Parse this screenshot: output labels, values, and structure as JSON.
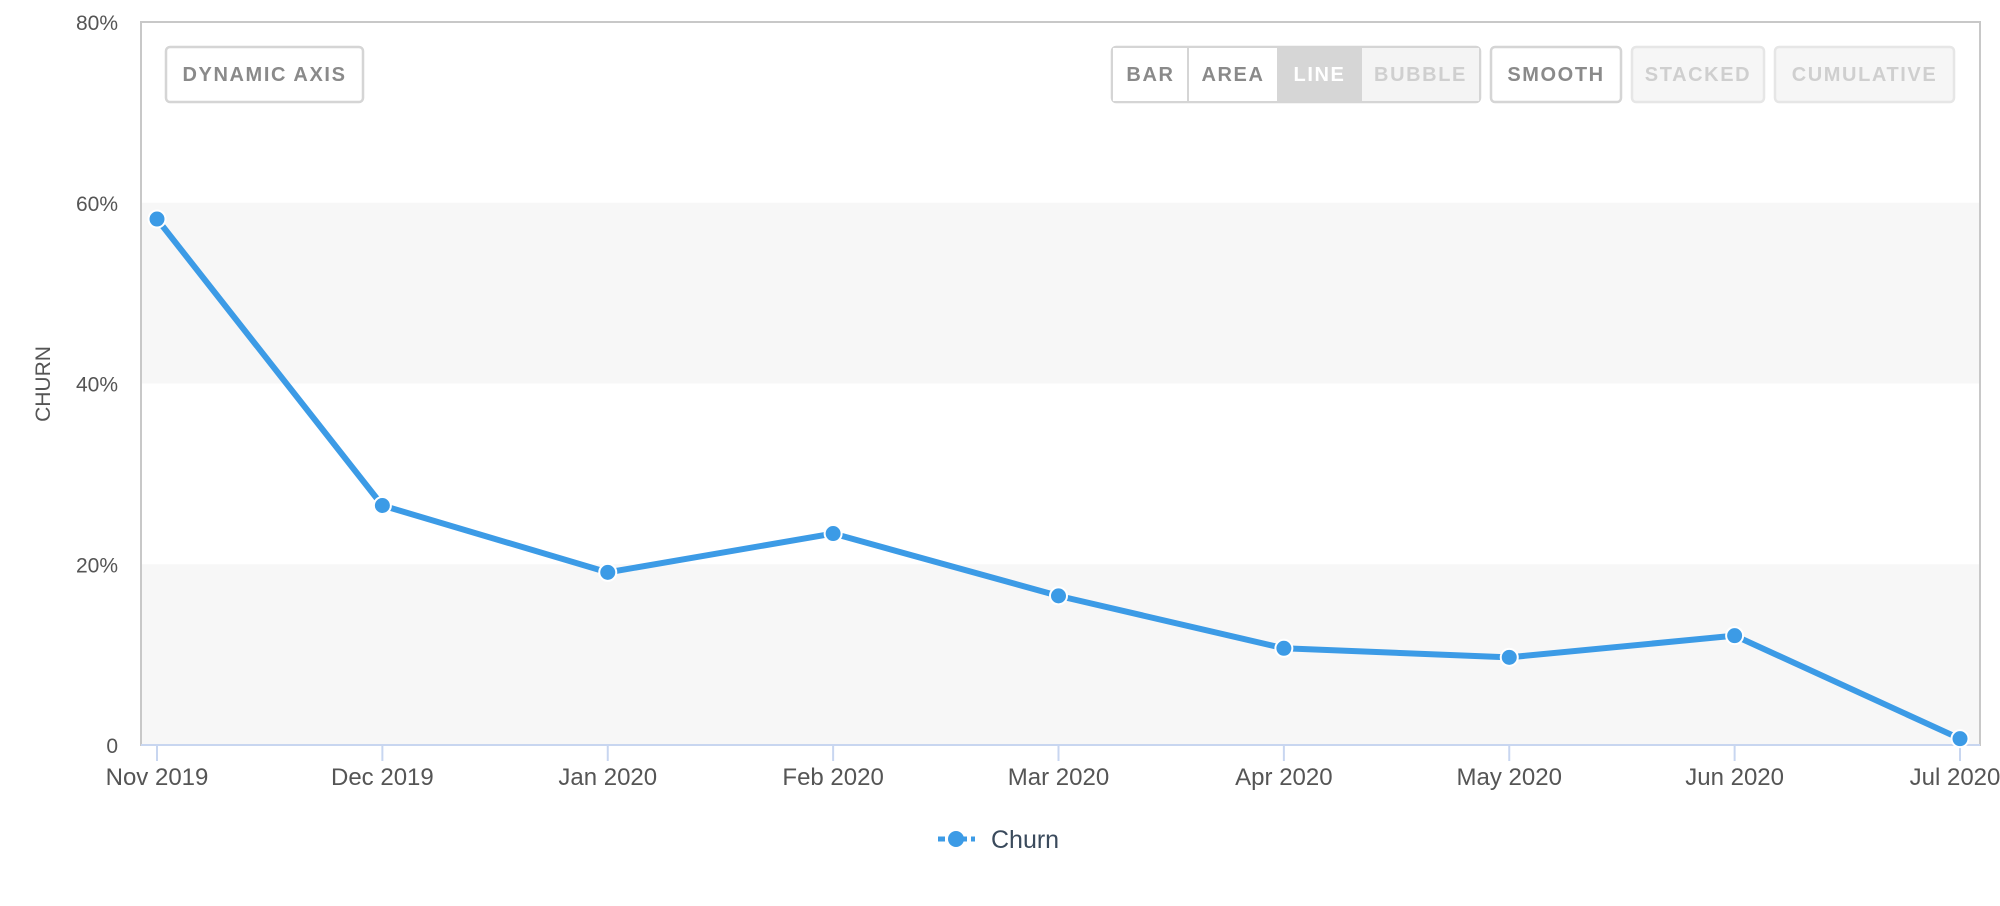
{
  "toolbar": {
    "dynamic_axis_label": "DYNAMIC AXIS",
    "bar_label": "BAR",
    "area_label": "AREA",
    "line_label": "LINE",
    "bubble_label": "BUBBLE",
    "smooth_label": "SMOOTH",
    "stacked_label": "STACKED",
    "cumulative_label": "CUMULATIVE",
    "active_mode": "LINE"
  },
  "colors": {
    "series": "#3c9be6",
    "band": "#f7f7f7",
    "axis": "#c8d6f0",
    "text": "#555555"
  },
  "chart_data": {
    "type": "line",
    "title": "",
    "xlabel": "",
    "ylabel": "CHURN",
    "categories": [
      "Nov 2019",
      "Dec 2019",
      "Jan 2020",
      "Feb 2020",
      "Mar 2020",
      "Apr 2020",
      "May 2020",
      "Jun 2020",
      "Jul 2020"
    ],
    "series": [
      {
        "name": "Churn",
        "values": [
          58.2,
          26.5,
          19.1,
          23.4,
          16.5,
          10.7,
          9.7,
          12.1,
          0.7
        ]
      }
    ],
    "ylim": [
      0,
      80
    ],
    "yticks": [
      0,
      20,
      40,
      60,
      80
    ],
    "ytick_labels": [
      "0",
      "20%",
      "40%",
      "60%",
      "80%"
    ],
    "alternating_bands": true,
    "legend_position": "bottom-center"
  }
}
